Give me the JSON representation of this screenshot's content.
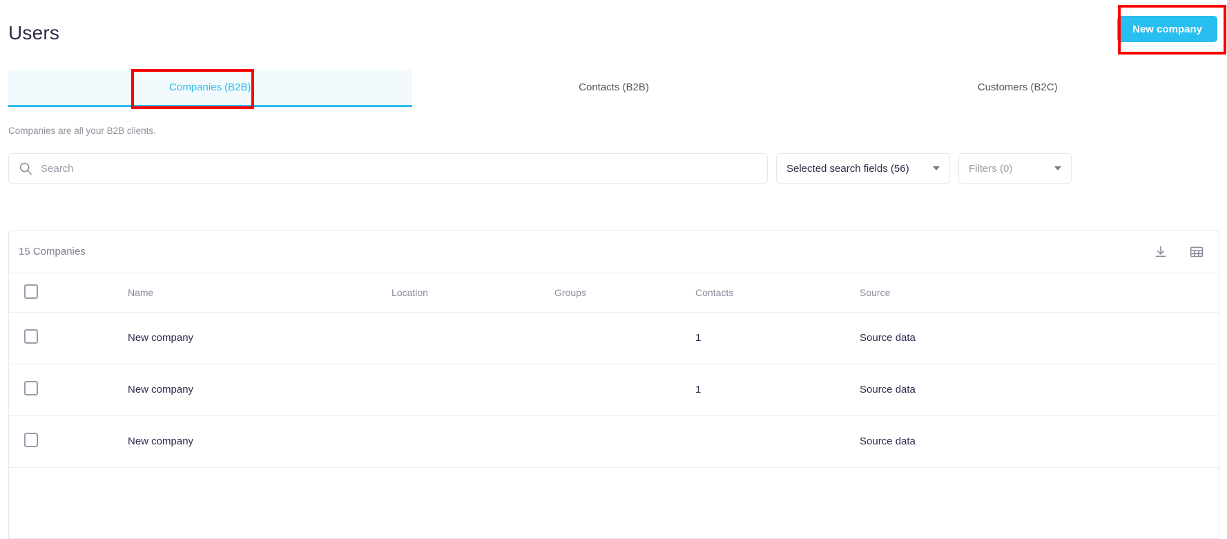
{
  "header": {
    "title": "Users",
    "new_company_label": "New company"
  },
  "tabs": [
    {
      "label": "Companies (B2B)",
      "active": true
    },
    {
      "label": "Contacts (B2B)",
      "active": false
    },
    {
      "label": "Customers (B2C)",
      "active": false
    }
  ],
  "subtitle": "Companies are all your B2B clients.",
  "search": {
    "placeholder": "Search",
    "value": "",
    "icon": "search-icon"
  },
  "dropdowns": {
    "search_fields_label": "Selected search fields (56)",
    "filters_label": "Filters (0)"
  },
  "table": {
    "count_label": "15 Companies",
    "actions": [
      {
        "name": "download-icon"
      },
      {
        "name": "grid-view-icon"
      }
    ],
    "columns": [
      "Name",
      "Location",
      "Groups",
      "Contacts",
      "Source"
    ],
    "rows": [
      {
        "name": "New company",
        "location": "",
        "groups": "",
        "contacts": "1",
        "source": "Source data"
      },
      {
        "name": "New company",
        "location": "",
        "groups": "",
        "contacts": "1",
        "source": "Source data"
      },
      {
        "name": "New company",
        "location": "",
        "groups": "",
        "contacts": "",
        "source": "Source data"
      }
    ]
  },
  "colors": {
    "accent": "#29bef0",
    "annotation": "#f70000",
    "text_dark": "#2b2b50",
    "text_muted": "#8a8a9c"
  }
}
